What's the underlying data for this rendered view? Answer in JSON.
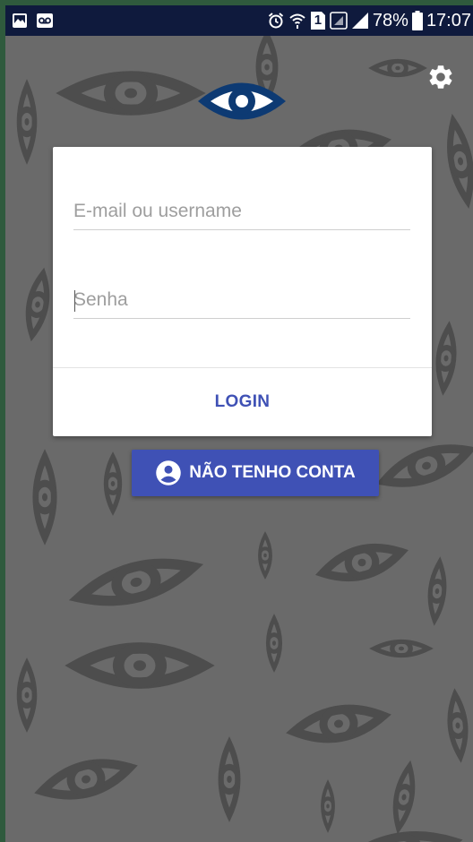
{
  "status_bar": {
    "battery_percent": "78%",
    "time": "17:07",
    "sim_slot": "1",
    "icons": [
      "gallery-icon",
      "voicemail-icon",
      "alarm-icon",
      "wifi-icon",
      "sim-icon",
      "signal-icon",
      "battery-icon"
    ]
  },
  "header": {
    "settings_icon": "gear-icon",
    "logo_icon": "eye-logo-icon"
  },
  "login_form": {
    "email_placeholder": "E-mail ou username",
    "password_placeholder": "Senha",
    "login_label": "LOGIN"
  },
  "signup": {
    "label": "NÃO TENHO CONTA",
    "icon": "account-circle-icon"
  },
  "colors": {
    "primary": "#3f51b5",
    "background": "#6a6a6a",
    "pattern": "#4d4d4d",
    "logo": "#0d3a73",
    "status_bar": "#0f1a3d"
  }
}
